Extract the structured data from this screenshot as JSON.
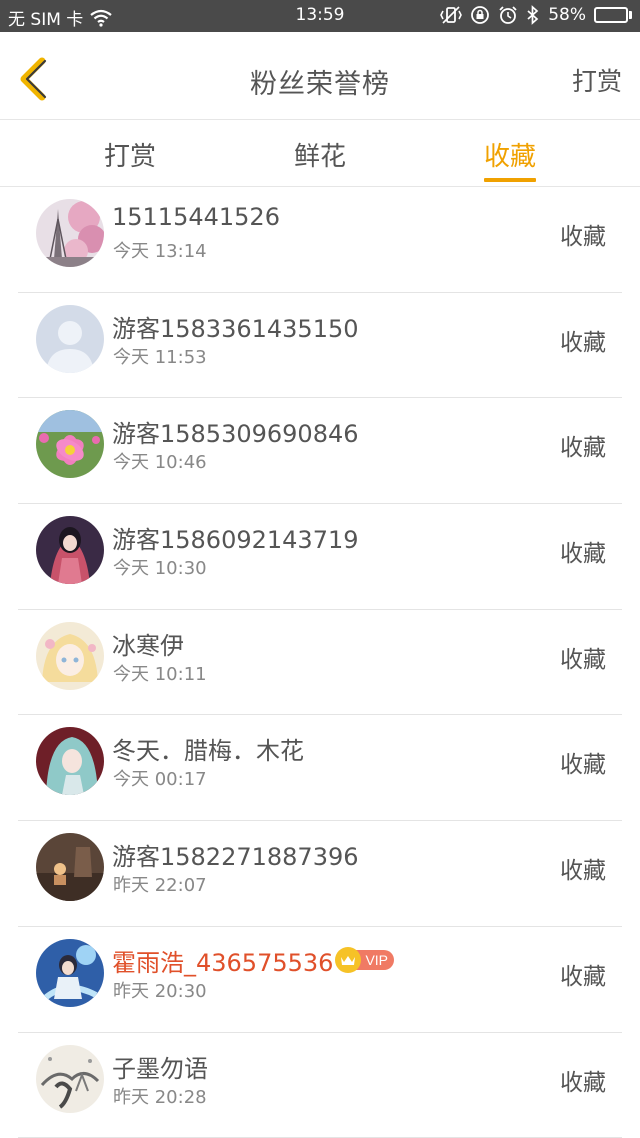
{
  "status_bar": {
    "carrier": "无 SIM 卡",
    "time": "13:59",
    "battery": "58%",
    "battery_level": 0.58
  },
  "header": {
    "title": "粉丝荣誉榜",
    "action_label": "打赏"
  },
  "tabs": [
    {
      "label": "打赏",
      "active": false
    },
    {
      "label": "鲜花",
      "active": false
    },
    {
      "label": "收藏",
      "active": true
    }
  ],
  "colors": {
    "accent": "#f0a100",
    "vip_name": "#e0502a",
    "vip_badge": "#f07a64",
    "crown": "#f6c227"
  },
  "fans": [
    {
      "name": "15115441526",
      "time": "今天 13:14",
      "kind": "收藏",
      "avatar": "eiffel-blossom"
    },
    {
      "name": "游客1583361435150",
      "time": "今天 11:53",
      "kind": "收藏",
      "avatar": "default-silhouette"
    },
    {
      "name": "游客1585309690846",
      "time": "今天 10:46",
      "kind": "收藏",
      "avatar": "pink-flower"
    },
    {
      "name": "游客1586092143719",
      "time": "今天 10:30",
      "kind": "收藏",
      "avatar": "anime-red-dress"
    },
    {
      "name": "冰寒伊",
      "time": "今天 10:11",
      "kind": "收藏",
      "avatar": "anime-blonde"
    },
    {
      "name": "冬天．腊梅．木花",
      "time": "今天 00:17",
      "kind": "收藏",
      "avatar": "anime-teal-hair"
    },
    {
      "name": "游客1582271887396",
      "time": "昨天 22:07",
      "kind": "收藏",
      "avatar": "dark-room"
    },
    {
      "name": "霍雨浩_436575536",
      "time": "昨天 20:30",
      "kind": "收藏",
      "avatar": "anime-blue-hero",
      "vip": true,
      "vip_label": "VIP"
    },
    {
      "name": "子墨勿语",
      "time": "昨天 20:28",
      "kind": "收藏",
      "avatar": "ink-painting"
    }
  ]
}
